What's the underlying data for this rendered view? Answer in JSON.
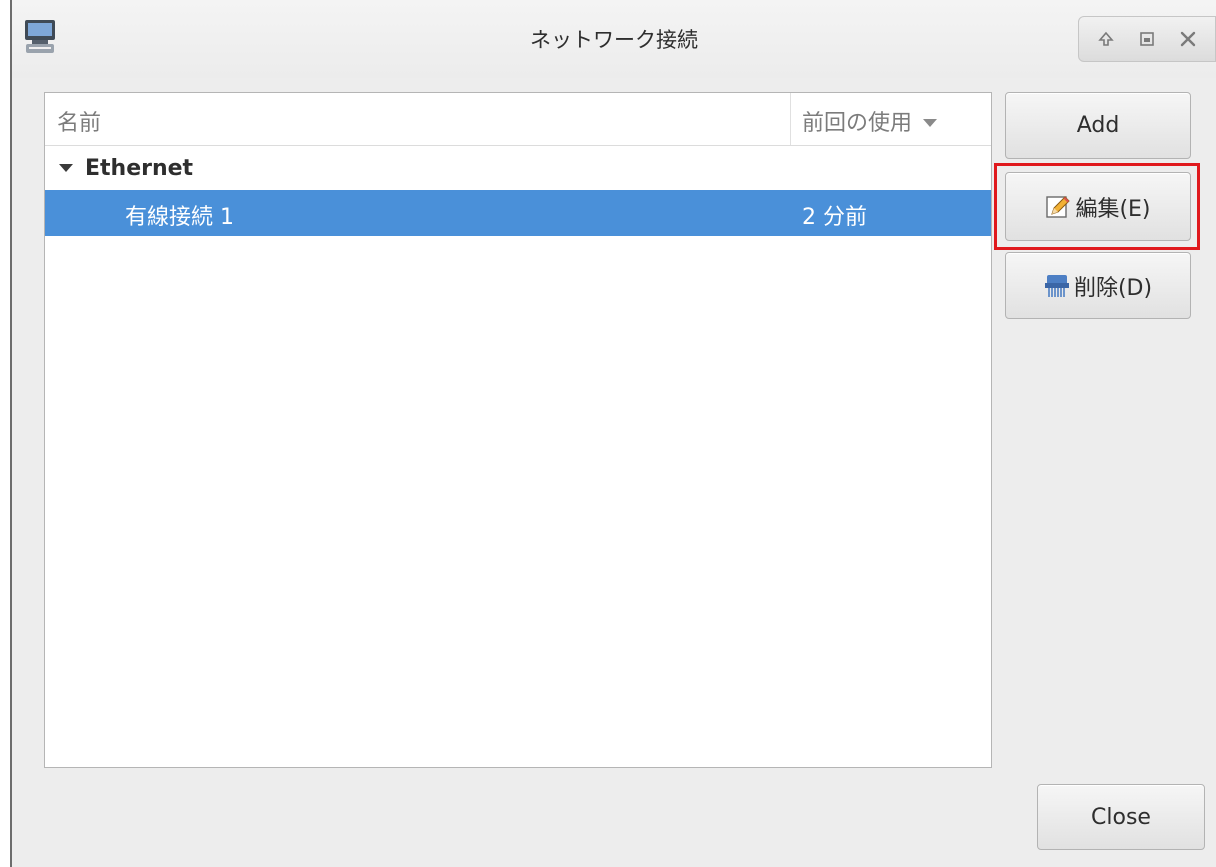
{
  "window": {
    "title": "ネットワーク接続"
  },
  "list": {
    "columns": {
      "name": "名前",
      "last_used": "前回の使用"
    },
    "group": {
      "label": "Ethernet"
    },
    "connections": [
      {
        "name": "有線接続 1",
        "last_used": "2 分前",
        "selected": true
      }
    ]
  },
  "buttons": {
    "add": "Add",
    "edit": "編集(E)",
    "delete": "削除(D)",
    "close": "Close"
  },
  "icons": {
    "app": "network-connections-icon",
    "wm_keep_above": "arrow-up-icon",
    "wm_maximize": "maximize-icon",
    "wm_close": "close-icon",
    "edit": "edit-pencil-icon",
    "delete": "delete-shredder-icon"
  },
  "colors": {
    "selection": "#4a90d9",
    "highlight_box": "#e0191d"
  }
}
